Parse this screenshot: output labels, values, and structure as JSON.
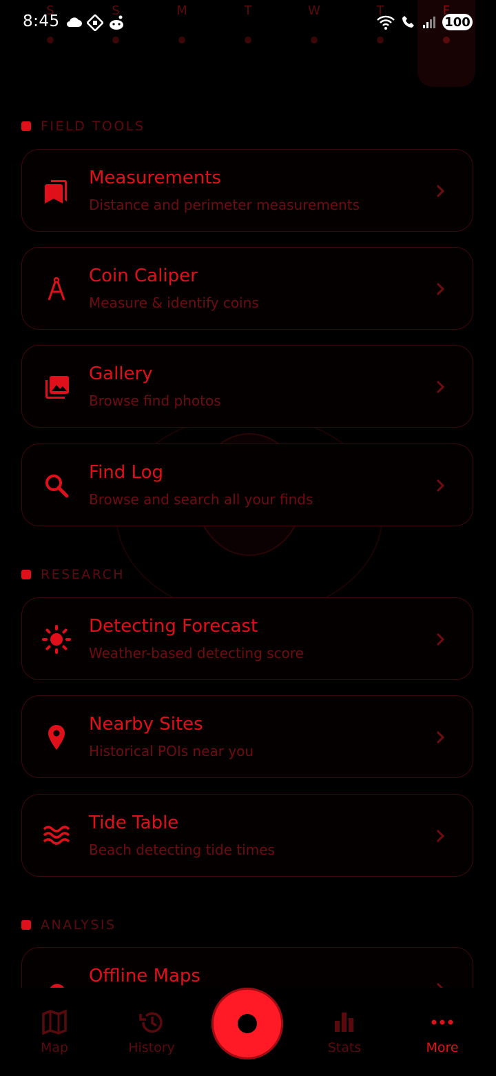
{
  "status_bar": {
    "time": "8:45",
    "battery": "100"
  },
  "week_strip": {
    "days": [
      "S",
      "S",
      "M",
      "T",
      "W",
      "T",
      "F"
    ]
  },
  "sections": {
    "field_tools": {
      "label": "FIELD TOOLS",
      "items": [
        {
          "title": "Measurements",
          "subtitle": "Distance and perimeter measurements",
          "icon": "bookmarks-icon"
        },
        {
          "title": "Coin Caliper",
          "subtitle": "Measure & identify coins",
          "icon": "compass-drawing-icon"
        },
        {
          "title": "Gallery",
          "subtitle": "Browse find photos",
          "icon": "photo-library-icon"
        },
        {
          "title": "Find Log",
          "subtitle": "Browse and search all your finds",
          "icon": "search-icon"
        }
      ]
    },
    "research": {
      "label": "RESEARCH",
      "items": [
        {
          "title": "Detecting Forecast",
          "subtitle": "Weather-based detecting score",
          "icon": "sun-icon"
        },
        {
          "title": "Nearby Sites",
          "subtitle": "Historical POIs near you",
          "icon": "location-pin-icon"
        },
        {
          "title": "Tide Table",
          "subtitle": "Beach detecting tide times",
          "icon": "waves-icon"
        }
      ]
    },
    "analysis": {
      "label": "ANALYSIS",
      "items": [
        {
          "title": "Offline Maps",
          "subtitle": "",
          "icon": "cloud-icon"
        }
      ]
    }
  },
  "bottom_nav": {
    "items": [
      {
        "label": "Map",
        "icon": "map-icon"
      },
      {
        "label": "History",
        "icon": "history-icon"
      },
      {
        "label": "Stats",
        "icon": "bar-chart-icon"
      },
      {
        "label": "More",
        "icon": "more-dots-icon"
      }
    ],
    "active": "More"
  },
  "colors": {
    "accent": "#e0101a",
    "dim": "#6e0c11",
    "border": "#3d080b",
    "background": "#000000"
  }
}
